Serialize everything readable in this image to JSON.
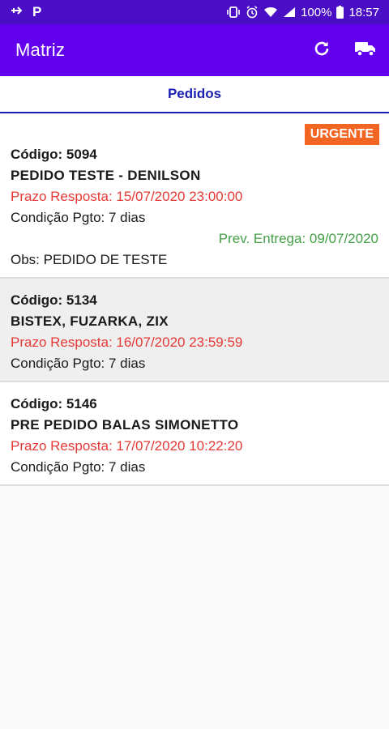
{
  "status_bar": {
    "battery": "100%",
    "time": "18:57"
  },
  "app_bar": {
    "title": "Matriz",
    "actions": [
      "refresh-icon",
      "truck-icon"
    ]
  },
  "tabs": [
    {
      "label": "Pedidos"
    }
  ],
  "orders": [
    {
      "badge": "URGENTE",
      "code": "Código: 5094",
      "name": "PEDIDO TESTE - DENILSON",
      "deadline": "Prazo Resposta: 15/07/2020 23:00:00",
      "condition": "Condição Pgto: 7 dias",
      "delivery": "Prev. Entrega: 09/07/2020",
      "obs": "Obs: PEDIDO DE TESTE"
    },
    {
      "code": "Código: 5134",
      "name": "BISTEX, FUZARKA, ZIX",
      "deadline": "Prazo Resposta: 16/07/2020 23:59:59",
      "condition": "Condição Pgto: 7 dias"
    },
    {
      "code": "Código: 5146",
      "name": "PRE PEDIDO BALAS SIMONETTO",
      "deadline": "Prazo Resposta: 17/07/2020 10:22:20",
      "condition": "Condição Pgto: 7 dias"
    }
  ],
  "colors": {
    "status_bar": "#4a0fc4",
    "app_bar": "#6200ee",
    "tab_text": "#1a1fb3",
    "badge": "#f26522",
    "deadline": "#e53935",
    "delivery": "#43a047"
  }
}
